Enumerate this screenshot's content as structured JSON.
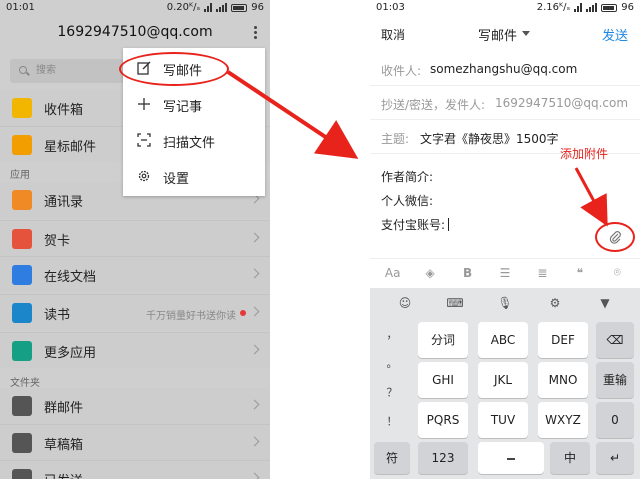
{
  "left_phone": {
    "status": {
      "time": "01:01",
      "speed": "0.20",
      "battery": "96"
    },
    "account": "1692947510@qq.com",
    "search_placeholder": "搜索",
    "menu": [
      {
        "label": "写邮件",
        "icon": "edit-icon"
      },
      {
        "label": "写记事",
        "icon": "plus-icon"
      },
      {
        "label": "扫描文件",
        "icon": "scan-icon"
      },
      {
        "label": "设置",
        "icon": "gear-icon"
      }
    ],
    "mailbox_items": [
      {
        "label": "收件箱",
        "icon": "inbox-icon",
        "color": "#f2b600"
      },
      {
        "label": "星标邮件",
        "icon": "star-icon",
        "color": "#f29d00"
      }
    ],
    "section_apps": "应用",
    "app_items": [
      {
        "label": "通讯录",
        "icon": "contacts-icon",
        "color": "#f08a24"
      },
      {
        "label": "贺卡",
        "icon": "card-icon",
        "color": "#e5533d"
      },
      {
        "label": "在线文档",
        "icon": "document-icon",
        "color": "#2f7de1"
      },
      {
        "label": "读书",
        "icon": "book-icon",
        "color": "#1b86c9",
        "note": "千万销量好书送你读"
      },
      {
        "label": "更多应用",
        "icon": "grid-icon",
        "color": "#15a086"
      }
    ],
    "section_folders": "文件夹",
    "folder_items": [
      {
        "label": "群邮件",
        "icon": "group-mail-icon",
        "color": "#555555"
      },
      {
        "label": "草稿箱",
        "icon": "drafts-icon",
        "color": "#555555"
      },
      {
        "label": "已发送",
        "icon": "sent-icon",
        "color": "#555555"
      }
    ]
  },
  "right_phone": {
    "status": {
      "time": "01:03",
      "speed": "2.16",
      "battery": "96"
    },
    "cancel": "取消",
    "title": "写邮件",
    "send": "发送",
    "to_label": "收件人:",
    "to_value": "somezhangshu@qq.com",
    "cc_label": "抄送/密送，发件人:",
    "cc_value": "1692947510@qq.com",
    "subject_label": "主题:",
    "subject_value": "文字君《静夜思》1500字",
    "body_lines": [
      "作者简介:",
      "个人微信:",
      "支付宝账号:"
    ],
    "annotation": "添加附件",
    "format_icons": [
      "Aa",
      "fill-icon",
      "B",
      "align-icon",
      "list-icon",
      "quote-icon",
      "location-icon"
    ],
    "format_bold": "B",
    "format_text": "Aa",
    "keyboard": {
      "toolbar": [
        "emoji-icon",
        "keyboard-icon",
        "mic-icon",
        "gear-icon",
        "collapse-icon"
      ],
      "punct": [
        "，",
        "。",
        "？",
        "！"
      ],
      "rows": [
        [
          "分词",
          "ABC",
          "DEF"
        ],
        [
          "GHI",
          "JKL",
          "MNO"
        ],
        [
          "PQRS",
          "TUV",
          "WXYZ"
        ]
      ],
      "delete": "backspace-icon",
      "reenter": "重输",
      "zero": "0",
      "sym": "符",
      "num": "123",
      "lang": "中",
      "enter": "enter-icon"
    }
  },
  "colors": {
    "accent_red": "#e8231c",
    "send_blue": "#1e88e5"
  }
}
